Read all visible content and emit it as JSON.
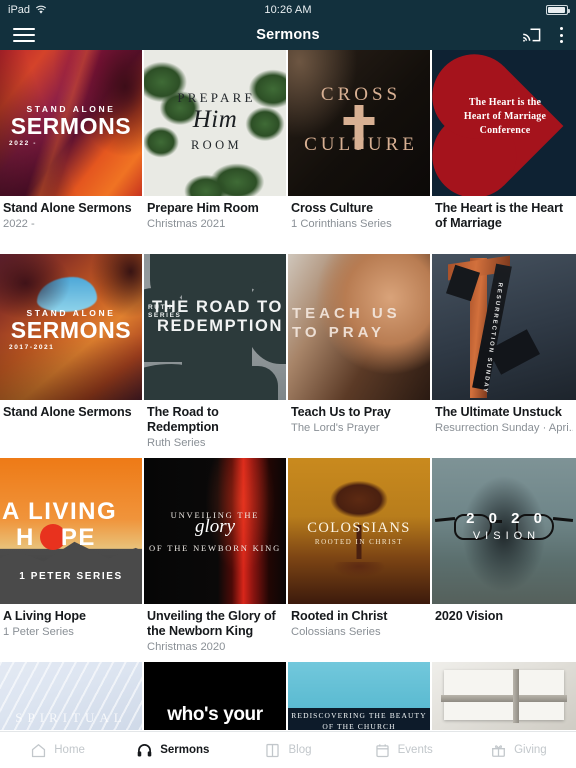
{
  "status_bar": {
    "device": "iPad",
    "wifi_icon": "wifi-icon",
    "time": "10:26 AM",
    "battery_icon": "battery-icon"
  },
  "app_bar": {
    "menu_icon": "hamburger-menu-icon",
    "title": "Sermons",
    "cast_icon": "cast-icon",
    "overflow_icon": "kebab-menu-icon",
    "background_color": "#12303d"
  },
  "series": [
    {
      "title": "Stand Alone Sermons",
      "subtitle": "2022 -",
      "art": {
        "line1": "STAND ALONE",
        "line2": "SERMONS",
        "line3": "2022 -"
      }
    },
    {
      "title": "Prepare Him Room",
      "subtitle": "Christmas 2021",
      "art": {
        "line1": "PREPARE",
        "line2": "Him",
        "line3": "ROOM"
      }
    },
    {
      "title": "Cross Culture",
      "subtitle": "1 Corinthians Series",
      "art": {
        "line1": "CROSS",
        "line2": "CULTURE"
      }
    },
    {
      "title": "The Heart is the Heart of Marriage",
      "subtitle": "",
      "art": {
        "line1": "The Heart is the",
        "line2": "Heart of Marriage",
        "line3": "Conference"
      }
    },
    {
      "title": "Stand Alone Sermons",
      "subtitle": "",
      "art": {
        "line1": "STAND ALONE",
        "line2": "SERMONS",
        "line3": "2017-2021"
      }
    },
    {
      "title": "The Road to Redemption",
      "subtitle": "Ruth Series",
      "art": {
        "line1": "RUTH",
        "line2": "SERIES",
        "line3": "THE ROAD TO",
        "line4": "REDEMPTION"
      }
    },
    {
      "title": "Teach Us to Pray",
      "subtitle": "The Lord's Prayer",
      "art": {
        "line1": "TEACH US",
        "line2": "TO PRAY"
      }
    },
    {
      "title": "The Ultimate Unstuck",
      "subtitle": "Resurrection Sunday · Apri...",
      "art": {
        "line1": "RESURRECTION SUNDAY"
      }
    },
    {
      "title": "A Living Hope",
      "subtitle": "1 Peter Series",
      "art": {
        "line1": "A LIVING",
        "line2": "H",
        "line3": "PE",
        "line4": "1 PETER SERIES"
      }
    },
    {
      "title": "Unveiling the Glory of the Newborn King",
      "subtitle": "Christmas 2020",
      "art": {
        "line1": "UNVEILING THE",
        "line2": "glory",
        "line3": "OF THE NEWBORN KING"
      }
    },
    {
      "title": "Rooted in Christ",
      "subtitle": "Colossians Series",
      "art": {
        "line1": "COLOSSIANS",
        "line2": "ROOTED IN CHRIST"
      }
    },
    {
      "title": "2020 Vision",
      "subtitle": "",
      "art": {
        "line1": "2 0 2 0",
        "line2": "VISION"
      }
    }
  ],
  "series_partial": [
    {
      "art": {
        "line1": "SPIRITUAL"
      }
    },
    {
      "art": {
        "line1": "who's your"
      }
    },
    {
      "art": {
        "line1": "REDISCOVERING THE BEAUTY",
        "line2": "OF THE CHURCH"
      }
    },
    {
      "art": {
        "line1": ""
      }
    }
  ],
  "tab_bar": {
    "items": [
      {
        "label": "Home",
        "icon": "home-icon",
        "active": false
      },
      {
        "label": "Sermons",
        "icon": "headphones-icon",
        "active": true
      },
      {
        "label": "Blog",
        "icon": "book-icon",
        "active": false
      },
      {
        "label": "Events",
        "icon": "calendar-icon",
        "active": false
      },
      {
        "label": "Giving",
        "icon": "gift-icon",
        "active": false
      }
    ]
  },
  "theme": {
    "accent": "#12303d",
    "title_color": "#16191c",
    "subtitle_color": "#8a9096",
    "tab_inactive": "#c2c7cb"
  }
}
